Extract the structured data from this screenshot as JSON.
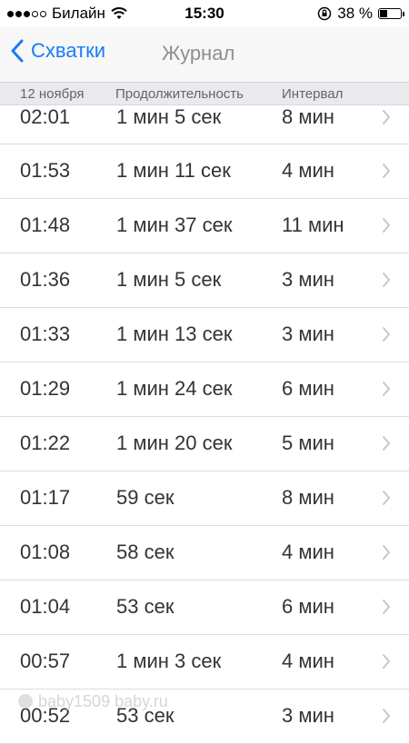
{
  "status_bar": {
    "carrier": "Билайн",
    "time": "15:30",
    "battery": "38 %",
    "battery_level": 0.38,
    "signal_bars_filled": 3,
    "signal_bars_total": 5
  },
  "nav": {
    "back_label": "Схватки",
    "title": "Журнал"
  },
  "table_header": {
    "date": "12 ноября",
    "duration": "Продолжительность",
    "interval": "Интервал"
  },
  "rows": [
    {
      "time": "02:01",
      "duration": "1 мин 5 сек",
      "interval": "8 мин"
    },
    {
      "time": "01:53",
      "duration": "1 мин 11 сек",
      "interval": "4 мин"
    },
    {
      "time": "01:48",
      "duration": "1 мин 37 сек",
      "interval": "11 мин"
    },
    {
      "time": "01:36",
      "duration": "1 мин 5 сек",
      "interval": "3 мин"
    },
    {
      "time": "01:33",
      "duration": "1 мин 13 сек",
      "interval": "3 мин"
    },
    {
      "time": "01:29",
      "duration": "1 мин 24 сек",
      "interval": "6 мин"
    },
    {
      "time": "01:22",
      "duration": "1 мин 20 сек",
      "interval": "5 мин"
    },
    {
      "time": "01:17",
      "duration": "59 сек",
      "interval": "8 мин"
    },
    {
      "time": "01:08",
      "duration": "58 сек",
      "interval": "4 мин"
    },
    {
      "time": "01:04",
      "duration": "53 сек",
      "interval": "6 мин"
    },
    {
      "time": "00:57",
      "duration": "1 мин 3 сек",
      "interval": "4 мин"
    },
    {
      "time": "00:52",
      "duration": "53 сек",
      "interval": "3 мин"
    }
  ],
  "watermark": "baby1509 baby.ru",
  "colors": {
    "accent": "#1a7cf5",
    "header_bg": "#e9e9ee",
    "separator": "#dcdcdf",
    "chevron": "#c7c7cc"
  }
}
